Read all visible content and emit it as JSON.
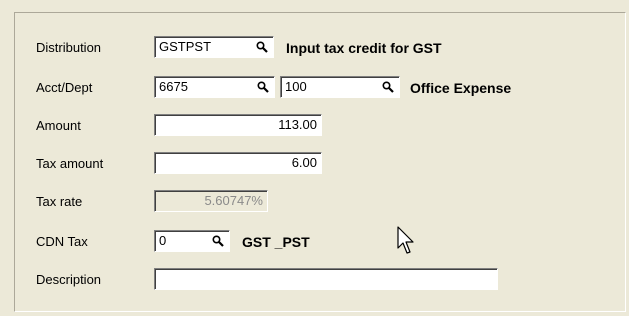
{
  "form": {
    "distribution": {
      "label": "Distribution",
      "code": "GSTPST",
      "description": "Input tax credit for GST"
    },
    "acct_dept": {
      "label": "Acct/Dept",
      "account": "6675",
      "dept": "100",
      "description": "Office Expense"
    },
    "amount": {
      "label": "Amount",
      "value": "113.00"
    },
    "tax_amount": {
      "label": "Tax amount",
      "value": "6.00"
    },
    "tax_rate": {
      "label": "Tax rate",
      "value": "5.60747%"
    },
    "cdn_tax": {
      "label": "CDN Tax",
      "code": "0",
      "description": "GST _PST"
    },
    "description": {
      "label": "Description",
      "value": ""
    }
  },
  "icons": {
    "lookup": "magnifier-icon",
    "pointer": "mouse-pointer-icon"
  }
}
